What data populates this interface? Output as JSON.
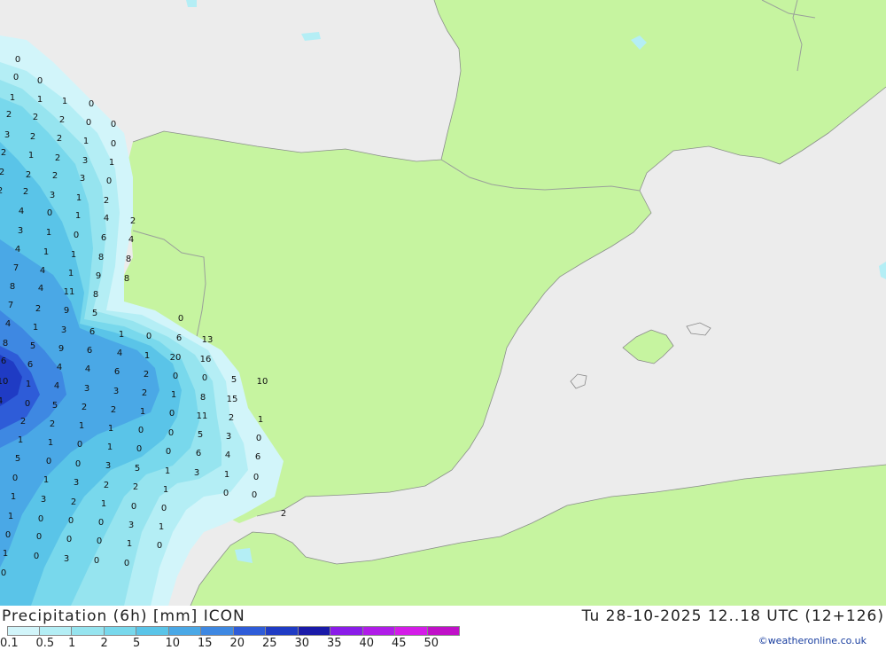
{
  "title": "Precipitation (6h) [mm] ICON",
  "valid_time": "Tu 28-10-2025 12..18 UTC (12+126)",
  "credit": "©weatheronline.co.uk",
  "legend": {
    "labels": [
      "0.1",
      "0.5",
      "1",
      "2",
      "5",
      "10",
      "15",
      "20",
      "25",
      "30",
      "35",
      "40",
      "45",
      "50"
    ],
    "colors": [
      "#d2f5fa",
      "#b4eef5",
      "#96e4ef",
      "#78d8ec",
      "#5ac4e8",
      "#4aa8e6",
      "#3e88e2",
      "#2e5cd8",
      "#1f3bc4",
      "#1a1aa8",
      "#8a1ce8",
      "#b01ce8",
      "#d41ce8",
      "#c010c8"
    ]
  },
  "colors": {
    "sea": "#ececec",
    "land": "#c6f4a0",
    "border": "#9aa09a"
  },
  "map_labels": [
    "0",
    "0",
    "0",
    "1",
    "1",
    "1",
    "0",
    "2",
    "2",
    "2",
    "0",
    "0",
    "3",
    "2",
    "2",
    "1",
    "0",
    "2",
    "1",
    "2",
    "3",
    "1",
    "2",
    "2",
    "2",
    "3",
    "0",
    "2",
    "2",
    "3",
    "1",
    "2",
    "4",
    "0",
    "1",
    "4",
    "2",
    "3",
    "1",
    "0",
    "6",
    "4",
    "4",
    "1",
    "1",
    "8",
    "8",
    "7",
    "4",
    "1",
    "9",
    "8",
    "8",
    "4",
    "11",
    "8",
    "7",
    "2",
    "9",
    "5",
    "4",
    "1",
    "3",
    "6",
    "1",
    "0",
    "0",
    "6",
    "13",
    "8",
    "5",
    "9",
    "6",
    "4",
    "1",
    "20",
    "16",
    "6",
    "6",
    "4",
    "4",
    "6",
    "2",
    "0",
    "0",
    "5",
    "10",
    "10",
    "1",
    "4",
    "3",
    "3",
    "2",
    "1",
    "8",
    "15",
    "4",
    "0",
    "5",
    "2",
    "2",
    "1",
    "0",
    "11",
    "2",
    "1",
    "2",
    "2",
    "1",
    "1",
    "0",
    "0",
    "5",
    "3",
    "0",
    "1",
    "1",
    "0",
    "1",
    "0",
    "0",
    "6",
    "4",
    "6",
    "5",
    "0",
    "0",
    "3",
    "5",
    "1",
    "3",
    "1",
    "0",
    "0",
    "1",
    "3",
    "2",
    "2",
    "1",
    "0",
    "0",
    "1",
    "3",
    "2",
    "1",
    "0",
    "0",
    "2",
    "1",
    "0",
    "0",
    "0",
    "3",
    "1",
    "0",
    "0",
    "0",
    "0",
    "1",
    "0",
    "1",
    "0",
    "3",
    "0",
    "0",
    "0"
  ]
}
